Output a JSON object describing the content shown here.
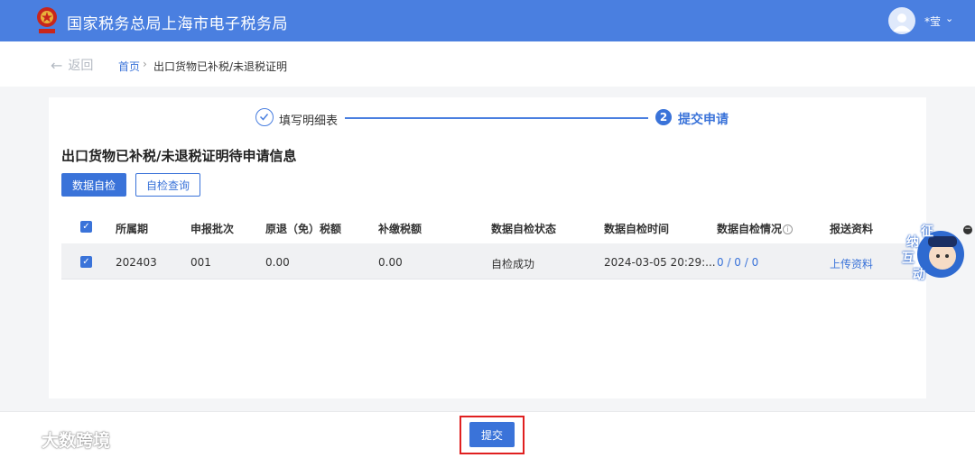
{
  "header": {
    "title": "国家税务总局上海市电子税务局",
    "user_name": "*莹",
    "user_caret": "⌄",
    "brand_color": "#4a7fe0"
  },
  "breadcrumb": {
    "back_label": "返回",
    "home": "首页",
    "separator": "›",
    "current": "出口货物已补税/未退税证明"
  },
  "stepper": {
    "step1_label": "填写明细表",
    "step2_number": "2",
    "step2_label": "提交申请"
  },
  "section_title": "出口货物已补税/未退税证明待申请信息",
  "actions": {
    "self_check": "数据自检",
    "check_query": "自检查询"
  },
  "table": {
    "headers": [
      "所属期",
      "申报批次",
      "原退（免）税额",
      "补缴税额",
      "数据自检状态",
      "数据自检时间",
      "数据自检情况",
      "报送资料"
    ],
    "rows": [
      {
        "period": "202403",
        "batch": "001",
        "refund": "0.00",
        "supplement": "0.00",
        "status": "自检成功",
        "time": "2024-03-05 20:29:...",
        "result": "0 / 0 / 0",
        "upload": "上传资料"
      }
    ]
  },
  "float_widget": {
    "line1": "征",
    "line2": "纳",
    "line3": "互",
    "line4": "动"
  },
  "footer": {
    "submit": "提交",
    "watermark": "大数跨境"
  }
}
